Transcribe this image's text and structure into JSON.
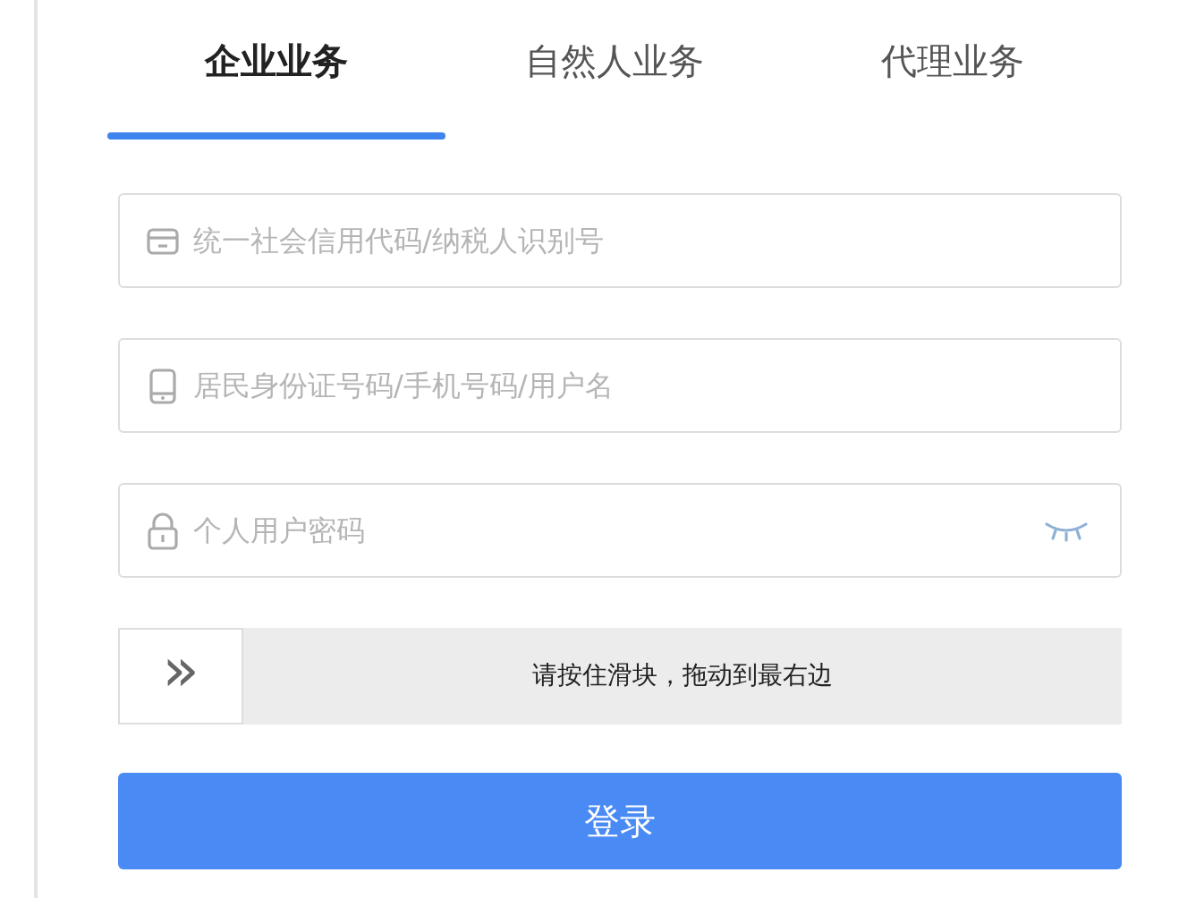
{
  "tabs": [
    {
      "label": "企业业务",
      "selected": true
    },
    {
      "label": "自然人业务",
      "selected": false
    },
    {
      "label": "代理业务",
      "selected": false
    }
  ],
  "fields": [
    {
      "kind": "card",
      "placeholder": "统一社会信用代码/纳税人识别号"
    },
    {
      "kind": "phone",
      "placeholder": "居民身份证号码/手机号码/用户名"
    },
    {
      "kind": "password",
      "placeholder": "个人用户密码"
    }
  ],
  "slider": {
    "handle": "»",
    "label": "请按住滑块，拖动到最右边",
    "level": 0
  },
  "login_button": "登录"
}
